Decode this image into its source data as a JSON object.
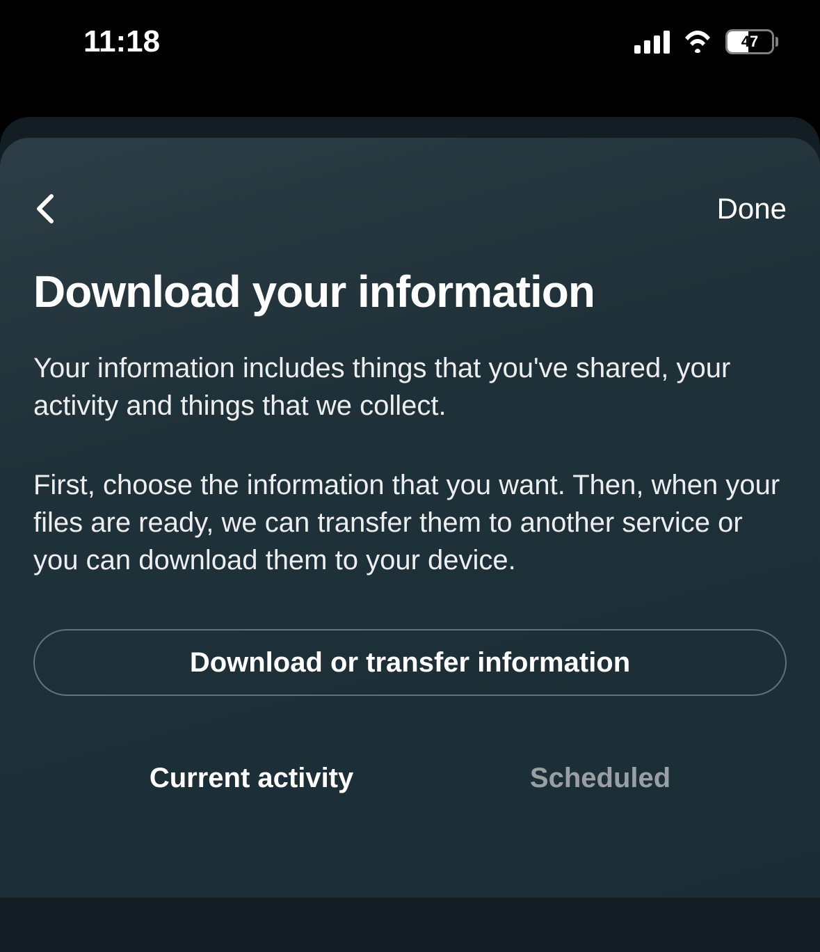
{
  "statusBar": {
    "time": "11:18",
    "battery": "47"
  },
  "nav": {
    "doneLabel": "Done"
  },
  "header": {
    "title": "Download your information"
  },
  "body": {
    "paragraph1": "Your information includes things that you've shared, your activity and things that we collect.",
    "paragraph2": "First, choose the information that you want. Then, when your files are ready, we can transfer them to another service or you can download them to your device."
  },
  "actions": {
    "primaryLabel": "Download or transfer information"
  },
  "tabs": {
    "currentActivity": "Current activity",
    "scheduled": "Scheduled"
  }
}
